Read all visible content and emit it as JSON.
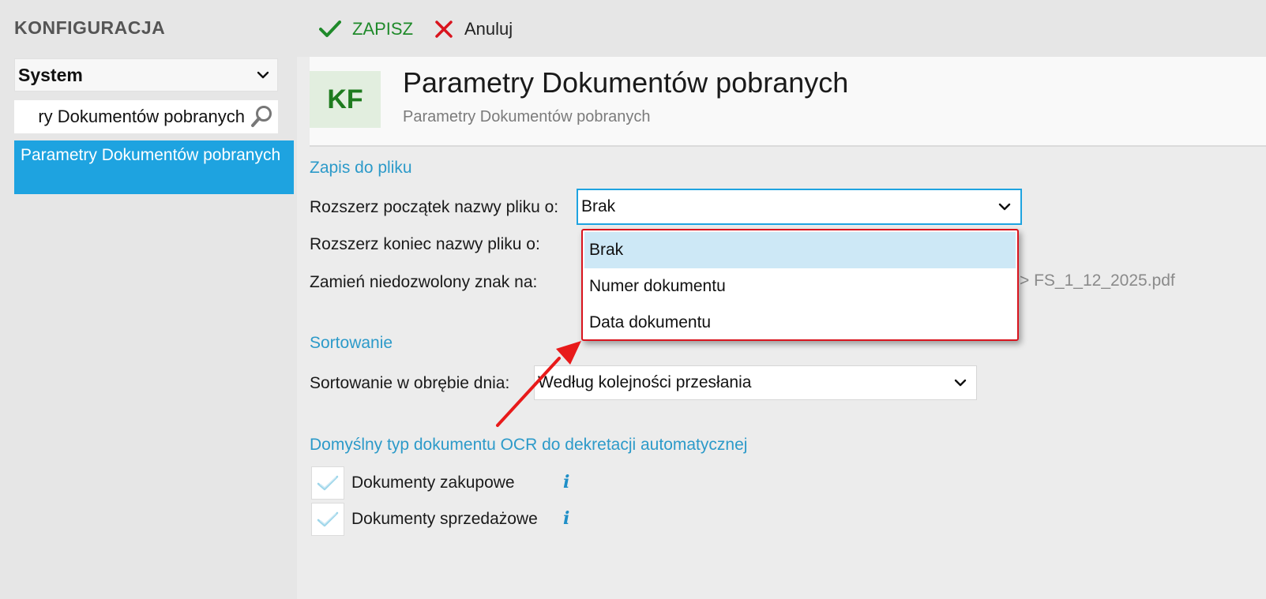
{
  "app": {
    "title": "KONFIGURACJA"
  },
  "toolbar": {
    "save_label": "ZAPISZ",
    "cancel_label": "Anuluj"
  },
  "sidebar": {
    "category": "System",
    "search_value": "Parametry Dokumentów pobranych",
    "search_visible_text": "ry Dokumentów pobranych",
    "items": [
      {
        "label": "Parametry Dokumentów pobranych",
        "active": true
      }
    ]
  },
  "header": {
    "tile": "KF",
    "title": "Parametry Dokumentów pobranych",
    "subtitle": "Parametry Dokumentów pobranych"
  },
  "zapis": {
    "section_title": "Zapis do pliku",
    "start_label": "Rozszerz początek nazwy pliku o:",
    "start_value": "Brak",
    "end_label": "Rozszerz koniec nazwy pliku o:",
    "replace_label": "Zamień niedozwolony znak na:",
    "preview_text": "> FS_1_12_2025.pdf",
    "dropdown_options": [
      "Brak",
      "Numer dokumentu",
      "Data dokumentu"
    ],
    "dropdown_selected": "Brak"
  },
  "sortowanie": {
    "section_title": "Sortowanie",
    "label": "Sortowanie w obrębie dnia:",
    "value": "Według kolejności przesłania"
  },
  "ocr": {
    "section_title": "Domyślny typ dokumentu OCR do dekretacji automatycznej",
    "options": [
      {
        "label": "Dokumenty zakupowe",
        "checked": true
      },
      {
        "label": "Dokumenty sprzedażowe",
        "checked": true
      }
    ]
  },
  "icons": {
    "save": "checkmark-icon",
    "cancel": "x-icon",
    "search": "magnifier-icon",
    "chevron": "chevron-down-icon",
    "info": "info-icon"
  },
  "colors": {
    "accent_blue": "#1ea3e0",
    "section_blue": "#2c9ac9",
    "save_green": "#1f8a2a",
    "cancel_red": "#d9141e",
    "highlight_red": "#d9141e",
    "selected_option": "#cde8f6"
  }
}
